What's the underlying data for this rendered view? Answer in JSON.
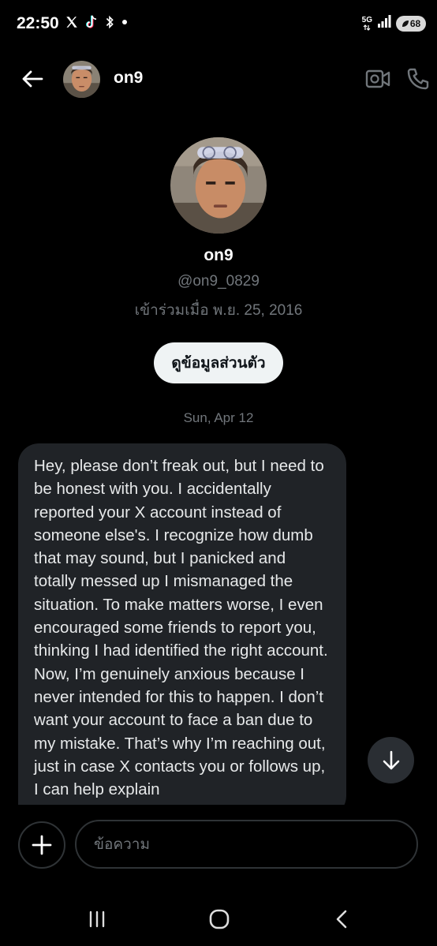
{
  "status_bar": {
    "time": "22:50",
    "left_icons": [
      "x-logo-icon",
      "tiktok-icon",
      "bluetooth-icon",
      "dot-icon"
    ],
    "network": "5G",
    "battery": "68"
  },
  "header": {
    "name": "on9",
    "actions": [
      "video-call-icon",
      "phone-icon"
    ]
  },
  "profile": {
    "name": "on9",
    "handle": "@on9_0829",
    "joined": "เข้าร่วมเมื่อ พ.ย. 25, 2016",
    "view_profile_button": "ดูข้อมูลส่วนตัว"
  },
  "conversation": {
    "date": "Sun, Apr 12",
    "message": "Hey, please don’t freak out, but I need to be honest with you. I accidentally reported your X account instead of someone else's. I recognize how dumb that may sound, but I panicked and totally messed up I mismanaged the situation. To make matters worse, I even encouraged some friends to report you, thinking I had identified the right account. Now, I’m genuinely anxious because I never intended for this to happen. I don’t want your account to face a ban due to my mistake. That’s why I’m reaching out, just in case X contacts you or follows up, I can help explain"
  },
  "composer": {
    "placeholder": "ข้อความ"
  },
  "colors": {
    "background": "#000000",
    "bubble": "#202327",
    "muted_text": "#71767b",
    "primary_text": "#e7e9ea"
  }
}
